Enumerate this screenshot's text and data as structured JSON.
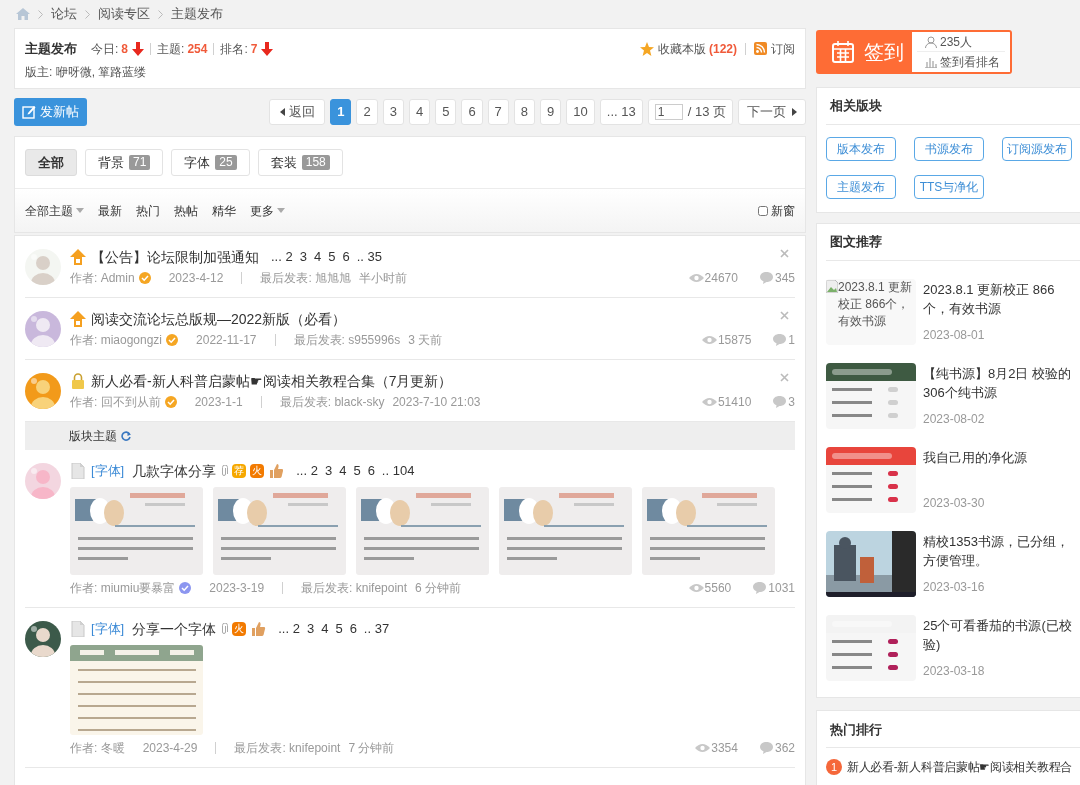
{
  "breadcrumb": [
    "论坛",
    "阅读专区",
    "主题发布"
  ],
  "forum": {
    "title": "主题发布",
    "stats": [
      {
        "label": "今日:",
        "value": "8",
        "falling": true
      },
      {
        "label": "主题:",
        "value": "254",
        "falling": false
      },
      {
        "label": "排名:",
        "value": "7",
        "falling": true
      }
    ],
    "moderators": "版主: 咿呀微, 箪路蓝缕",
    "favorite": {
      "label": "收藏本版",
      "count": "(122)"
    },
    "subscribe": "订阅"
  },
  "new_post_button": "发新帖",
  "pagination": {
    "prev": "返回",
    "pages": [
      {
        "label": "1",
        "selected": true
      },
      {
        "label": "2",
        "selected": false
      },
      {
        "label": "3",
        "selected": false
      },
      {
        "label": "4",
        "selected": false
      },
      {
        "label": "5",
        "selected": false
      },
      {
        "label": "6",
        "selected": false
      },
      {
        "label": "7",
        "selected": false
      },
      {
        "label": "8",
        "selected": false
      },
      {
        "label": "9",
        "selected": false
      },
      {
        "label": "10",
        "selected": false
      },
      {
        "label": "... 13",
        "selected": false
      }
    ],
    "page_input": "1",
    "total": "/ 13 页",
    "next": "下一页"
  },
  "type_tabs": [
    {
      "label": "全部",
      "selected": true
    },
    {
      "label": "背景",
      "count": "71",
      "selected": false
    },
    {
      "label": "字体",
      "count": "25",
      "selected": false
    },
    {
      "label": "套装",
      "count": "158",
      "selected": false
    }
  ],
  "sort_links": [
    {
      "label": "全部主题",
      "dropdown": true
    },
    {
      "label": "最新",
      "dropdown": false
    },
    {
      "label": "热门",
      "dropdown": false
    },
    {
      "label": "热帖",
      "dropdown": false
    },
    {
      "label": "精华",
      "dropdown": false
    },
    {
      "label": "更多",
      "dropdown": true
    }
  ],
  "new_window": {
    "label": "新窗",
    "checked": false
  },
  "thread_list": [
    {
      "kind": "pinned",
      "title": "【公告】论坛限制加强通知",
      "pages": [
        "... 2",
        "3",
        "4",
        "5",
        "6",
        ".. 35"
      ],
      "closable": true,
      "author": "作者: Admin",
      "verified": true,
      "color": "#f5a623",
      "date": "2023-4-12",
      "last_post": "最后发表: 旭旭旭",
      "last_time": "半小时前",
      "views": "24670",
      "replies": "345"
    },
    {
      "kind": "pinned",
      "title": "阅读交流论坛总版规—2022新版（必看）",
      "closable": true,
      "author": "作者: miaogongzi",
      "verified": true,
      "color": "#f5a623",
      "date": "2022-11-17",
      "last_post": "最后发表: s955996s",
      "last_time": "3 天前",
      "views": "15875",
      "replies": "1"
    },
    {
      "kind": "locked",
      "title": "新人必看-新人科普启蒙帖☛阅读相关教程合集（7月更新）",
      "closable": true,
      "author": "作者: 回不到从前",
      "verified": true,
      "color": "#f5a623",
      "date": "2023-1-1",
      "last_post": "最后发表: black-sky",
      "last_time": "2023-7-10 21:03",
      "views": "51410",
      "replies": "3"
    },
    {
      "kind": "section",
      "label": "版块主题"
    },
    {
      "kind": "thread",
      "category": "[字体]",
      "title": "几款字体分享",
      "badges": [
        {
          "kind": "attachment"
        },
        {
          "kind": "recommend",
          "label": "荐"
        },
        {
          "kind": "hot",
          "label": "火"
        },
        {
          "kind": "thumb"
        }
      ],
      "pages": [
        "... 2",
        "3",
        "4",
        "5",
        "6",
        ".. 104"
      ],
      "previews": [
        {
          "kind": "picture"
        },
        {
          "kind": "picture"
        },
        {
          "kind": "picture"
        },
        {
          "kind": "picture"
        },
        {
          "kind": "picture"
        }
      ],
      "closable": false,
      "author": "作者: miumiu要暴富",
      "verified": true,
      "color": "#8c96f0",
      "date": "2023-3-19",
      "last_post": "最后发表: knifepoint",
      "last_time": "6 分钟前",
      "views": "5560",
      "replies": "1031"
    },
    {
      "kind": "thread",
      "category": "[字体]",
      "title": "分享一个字体",
      "badges": [
        {
          "kind": "attachment"
        },
        {
          "kind": "hot",
          "label": "火"
        },
        {
          "kind": "thumb"
        }
      ],
      "pages": [
        "... 2",
        "3",
        "4",
        "5",
        "6",
        ".. 37"
      ],
      "previews": [
        {
          "kind": "picture"
        }
      ],
      "closable": false,
      "author": "作者: 冬暖",
      "verified": false,
      "date": "2023-4-29",
      "last_post": "最后发表: knifepoint",
      "last_time": "7 分钟前",
      "views": "3354",
      "replies": "362"
    }
  ],
  "sign_in": {
    "label": "签到",
    "count": "235人",
    "ranking": "签到看排名"
  },
  "related_forums": {
    "title": "相关版块",
    "links": [
      "版本发布",
      "书源发布",
      "订阅源发布",
      "主题发布",
      "TTS与净化"
    ]
  },
  "recommended": {
    "title": "图文推荐",
    "items": [
      {
        "title": "2023.8.1 更新校正 866个，有效书源",
        "date": "2023-08-01",
        "image": {
          "kind": "broken",
          "alt": "2023.8.1 更新校正 866个，有效书源"
        }
      },
      {
        "title": "【纯书源】8月2日 校验的306个纯书源",
        "date": "2023-08-02",
        "image": {
          "kind": "picture"
        }
      },
      {
        "title": "我自己用的净化源",
        "date": "2023-03-30",
        "image": {
          "kind": "picture"
        }
      },
      {
        "title": "精校1353书源，已分组，方便管理。",
        "date": "2023-03-16",
        "image": {
          "kind": "picture"
        }
      },
      {
        "title": "25个可看番茄的书源(已校验)",
        "date": "2023-03-18",
        "image": {
          "kind": "picture"
        }
      }
    ]
  },
  "hot_ranking": {
    "title": "热门排行",
    "items": [
      {
        "rank": "1",
        "title": "新人必看-新人科普启蒙帖☛阅读相关教程合"
      }
    ]
  }
}
